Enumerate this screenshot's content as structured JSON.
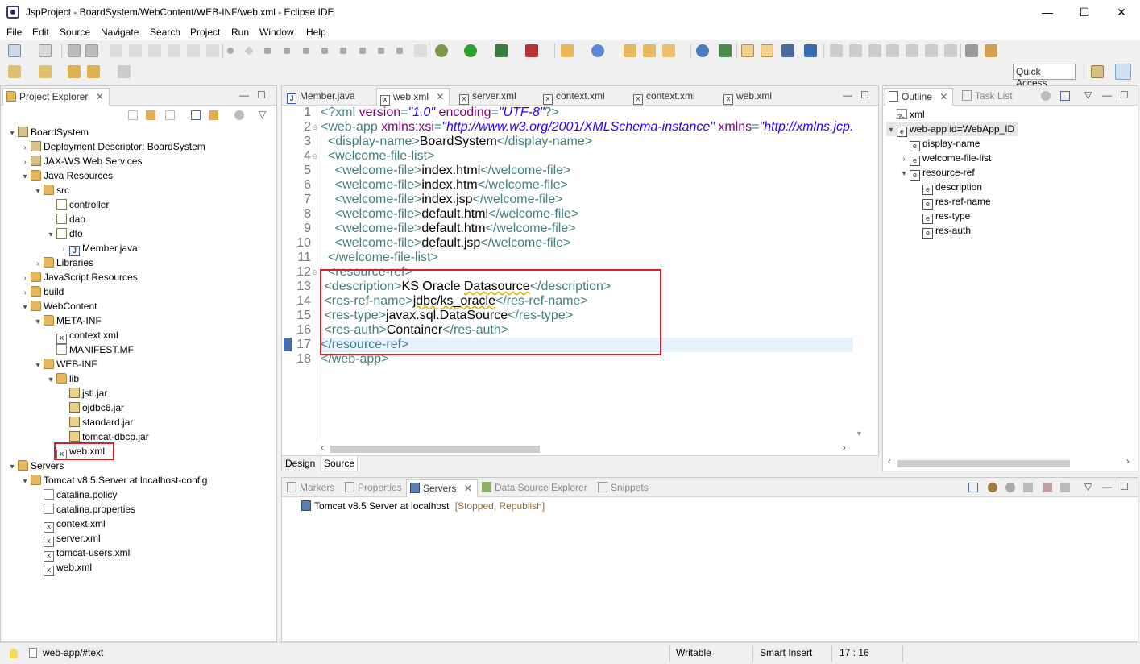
{
  "window": {
    "title": "JspProject - BoardSystem/WebContent/WEB-INF/web.xml - Eclipse IDE",
    "minimize": "—",
    "maximize": "☐",
    "close": "✕"
  },
  "menu": [
    "File",
    "Edit",
    "Source",
    "Navigate",
    "Search",
    "Project",
    "Run",
    "Window",
    "Help"
  ],
  "toolbar": {
    "quick_access": "Quick Access"
  },
  "project_explorer": {
    "title": "Project Explorer",
    "tree": [
      {
        "label": "BoardSystem",
        "icon": "project-icon",
        "twist": "▾"
      },
      {
        "label": "Deployment Descriptor: BoardSystem",
        "icon": "descriptor-icon",
        "twist": "›"
      },
      {
        "label": "JAX-WS Web Services",
        "icon": "webservice-icon",
        "twist": "›"
      },
      {
        "label": "Java Resources",
        "icon": "java-resources-icon",
        "twist": "▾"
      },
      {
        "label": "src",
        "icon": "source-folder-icon",
        "twist": "▾"
      },
      {
        "label": "controller",
        "icon": "package-icon",
        "twist": ""
      },
      {
        "label": "dao",
        "icon": "package-icon",
        "twist": ""
      },
      {
        "label": "dto",
        "icon": "package-icon",
        "twist": "▾"
      },
      {
        "label": "Member.java",
        "icon": "java-file-icon",
        "twist": "›"
      },
      {
        "label": "Libraries",
        "icon": "library-icon",
        "twist": "›"
      },
      {
        "label": "JavaScript Resources",
        "icon": "js-resources-icon",
        "twist": "›"
      },
      {
        "label": "build",
        "icon": "folder-icon",
        "twist": "›"
      },
      {
        "label": "WebContent",
        "icon": "folder-icon",
        "twist": "▾"
      },
      {
        "label": "META-INF",
        "icon": "folder-icon",
        "twist": "▾"
      },
      {
        "label": "context.xml",
        "icon": "xml-file-icon",
        "twist": ""
      },
      {
        "label": "MANIFEST.MF",
        "icon": "file-icon",
        "twist": ""
      },
      {
        "label": "WEB-INF",
        "icon": "folder-icon",
        "twist": "▾"
      },
      {
        "label": "lib",
        "icon": "folder-icon",
        "twist": "▾"
      },
      {
        "label": "jstl.jar",
        "icon": "jar-icon",
        "twist": ""
      },
      {
        "label": "ojdbc6.jar",
        "icon": "jar-icon",
        "twist": ""
      },
      {
        "label": "standard.jar",
        "icon": "jar-icon",
        "twist": ""
      },
      {
        "label": "tomcat-dbcp.jar",
        "icon": "jar-icon",
        "twist": ""
      },
      {
        "label": "web.xml",
        "icon": "xml-file-icon",
        "twist": ""
      },
      {
        "label": "Servers",
        "icon": "folder-icon",
        "twist": "▾"
      },
      {
        "label": "Tomcat v8.5 Server at localhost-config",
        "icon": "folder-icon",
        "twist": "▾"
      },
      {
        "label": "catalina.policy",
        "icon": "file-icon",
        "twist": ""
      },
      {
        "label": "catalina.properties",
        "icon": "file-icon",
        "twist": ""
      },
      {
        "label": "context.xml",
        "icon": "xml-file-icon",
        "twist": ""
      },
      {
        "label": "server.xml",
        "icon": "xml-file-icon",
        "twist": ""
      },
      {
        "label": "tomcat-users.xml",
        "icon": "xml-file-icon",
        "twist": ""
      },
      {
        "label": "web.xml",
        "icon": "xml-file-icon",
        "twist": ""
      }
    ]
  },
  "editor": {
    "tabs": [
      {
        "label": "Member.java",
        "icon": "java-file-icon"
      },
      {
        "label": "web.xml",
        "icon": "xml-file-icon"
      },
      {
        "label": "server.xml",
        "icon": "xml-file-icon"
      },
      {
        "label": "context.xml",
        "icon": "xml-file-icon"
      },
      {
        "label": "context.xml",
        "icon": "xml-file-icon"
      },
      {
        "label": "web.xml",
        "icon": "xml-file-icon"
      }
    ],
    "active_tab": 1,
    "bottom_tabs": [
      "Design",
      "Source"
    ],
    "lines": [
      {
        "n": "1",
        "fold": "",
        "parts": [
          [
            "pi",
            "<?xml "
          ],
          [
            "attr",
            "version"
          ],
          [
            "pi",
            "="
          ],
          [
            "val",
            "\"1.0\""
          ],
          [
            "pi",
            " "
          ],
          [
            "attr",
            "encoding"
          ],
          [
            "pi",
            "="
          ],
          [
            "val",
            "\"UTF-8\""
          ],
          [
            "pi",
            "?>"
          ]
        ]
      },
      {
        "n": "2",
        "fold": "⊖",
        "parts": [
          [
            "tag",
            "<web-app "
          ],
          [
            "attr",
            "xmlns:xsi"
          ],
          [
            "tag",
            "="
          ],
          [
            "val",
            "\"http://www.w3.org/2001/XMLSchema-instance\""
          ],
          [
            "tag",
            " "
          ],
          [
            "attr",
            "xmlns"
          ],
          [
            "tag",
            "="
          ],
          [
            "val",
            "\"http://xmlns.jcp.org/xml/ns/javaee\""
          ]
        ]
      },
      {
        "n": "3",
        "fold": "",
        "parts": [
          [
            "text",
            "  "
          ],
          [
            "tag",
            "<display-name>"
          ],
          [
            "text",
            "BoardSystem"
          ],
          [
            "tag",
            "</display-name>"
          ]
        ]
      },
      {
        "n": "4",
        "fold": "⊖",
        "parts": [
          [
            "text",
            "  "
          ],
          [
            "tag",
            "<welcome-file-list>"
          ]
        ]
      },
      {
        "n": "5",
        "fold": "",
        "parts": [
          [
            "text",
            "    "
          ],
          [
            "tag",
            "<welcome-file>"
          ],
          [
            "text",
            "index.html"
          ],
          [
            "tag",
            "</welcome-file>"
          ]
        ]
      },
      {
        "n": "6",
        "fold": "",
        "parts": [
          [
            "text",
            "    "
          ],
          [
            "tag",
            "<welcome-file>"
          ],
          [
            "text",
            "index.htm"
          ],
          [
            "tag",
            "</welcome-file>"
          ]
        ]
      },
      {
        "n": "7",
        "fold": "",
        "parts": [
          [
            "text",
            "    "
          ],
          [
            "tag",
            "<welcome-file>"
          ],
          [
            "text",
            "index.jsp"
          ],
          [
            "tag",
            "</welcome-file>"
          ]
        ]
      },
      {
        "n": "8",
        "fold": "",
        "parts": [
          [
            "text",
            "    "
          ],
          [
            "tag",
            "<welcome-file>"
          ],
          [
            "text",
            "default.html"
          ],
          [
            "tag",
            "</welcome-file>"
          ]
        ]
      },
      {
        "n": "9",
        "fold": "",
        "parts": [
          [
            "text",
            "    "
          ],
          [
            "tag",
            "<welcome-file>"
          ],
          [
            "text",
            "default.htm"
          ],
          [
            "tag",
            "</welcome-file>"
          ]
        ]
      },
      {
        "n": "10",
        "fold": "",
        "parts": [
          [
            "text",
            "    "
          ],
          [
            "tag",
            "<welcome-file>"
          ],
          [
            "text",
            "default.jsp"
          ],
          [
            "tag",
            "</welcome-file>"
          ]
        ]
      },
      {
        "n": "11",
        "fold": "",
        "parts": [
          [
            "text",
            "  "
          ],
          [
            "tag",
            "</welcome-file-list>"
          ]
        ]
      },
      {
        "n": "12",
        "fold": "⊖",
        "parts": [
          [
            "text",
            "  "
          ],
          [
            "tag",
            "<resource-ref>"
          ]
        ]
      },
      {
        "n": "13",
        "fold": "",
        "parts": [
          [
            "text",
            " "
          ],
          [
            "tag",
            "<description>"
          ],
          [
            "text",
            "KS Oracle "
          ],
          [
            "spell",
            "Datasource"
          ],
          [
            "tag",
            "</description>"
          ]
        ]
      },
      {
        "n": "14",
        "fold": "",
        "parts": [
          [
            "text",
            " "
          ],
          [
            "tag",
            "<res-ref-name>"
          ],
          [
            "spell",
            "jdbc"
          ],
          [
            "text",
            "/"
          ],
          [
            "spell",
            "ks_oracle"
          ],
          [
            "tag",
            "</res-ref-name>"
          ]
        ]
      },
      {
        "n": "15",
        "fold": "",
        "parts": [
          [
            "text",
            " "
          ],
          [
            "tag",
            "<res-type>"
          ],
          [
            "text",
            "javax.sql.DataSource"
          ],
          [
            "tag",
            "</res-type>"
          ]
        ]
      },
      {
        "n": "16",
        "fold": "",
        "parts": [
          [
            "text",
            " "
          ],
          [
            "tag",
            "<res-auth>"
          ],
          [
            "text",
            "Container"
          ],
          [
            "tag",
            "</res-auth>"
          ]
        ]
      },
      {
        "n": "17",
        "fold": "",
        "parts": [
          [
            "tag",
            "</resource-ref>"
          ]
        ]
      },
      {
        "n": "18",
        "fold": "",
        "parts": [
          [
            "tag",
            "</web-app>"
          ]
        ]
      }
    ]
  },
  "outline": {
    "title": "Outline",
    "task_list": "Task List",
    "tree": [
      {
        "label": "xml",
        "icon": "pi-icon",
        "twist": ""
      },
      {
        "label": "web-app id=WebApp_ID",
        "icon": "element-icon",
        "twist": "▾"
      },
      {
        "label": "display-name",
        "icon": "element-icon",
        "twist": ""
      },
      {
        "label": "welcome-file-list",
        "icon": "element-icon",
        "twist": "›"
      },
      {
        "label": "resource-ref",
        "icon": "element-icon",
        "twist": "▾"
      },
      {
        "label": "description",
        "icon": "element-icon",
        "twist": ""
      },
      {
        "label": "res-ref-name",
        "icon": "element-icon",
        "twist": ""
      },
      {
        "label": "res-type",
        "icon": "element-icon",
        "twist": ""
      },
      {
        "label": "res-auth",
        "icon": "element-icon",
        "twist": ""
      }
    ]
  },
  "bottom_panel": {
    "tabs": [
      "Markers",
      "Properties",
      "Servers",
      "Data Source Explorer",
      "Snippets"
    ],
    "active_tab": 2,
    "server_name": "Tomcat v8.5 Server at localhost",
    "server_status": "[Stopped, Republish]"
  },
  "status": {
    "path": "web-app/#text",
    "mode": "Writable",
    "insert": "Smart Insert",
    "position": "17 : 16"
  },
  "colors": {
    "highlight_box": "#d6202a",
    "tag": "#3f7f7f",
    "attr": "#7f007f",
    "value": "#2a00ff"
  }
}
